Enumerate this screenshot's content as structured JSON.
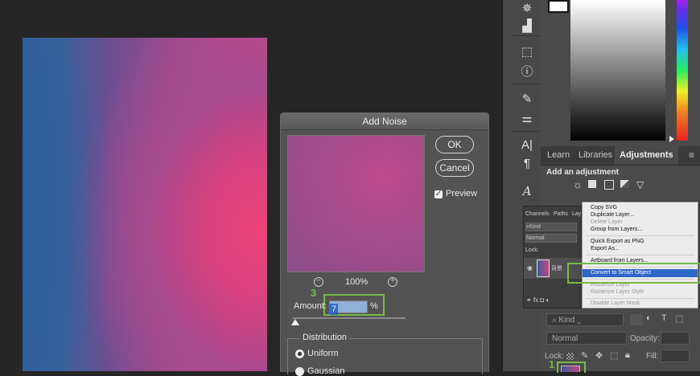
{
  "dialog": {
    "title": "Add Noise",
    "ok_label": "OK",
    "cancel_label": "Cancel",
    "preview_label": "Preview",
    "preview_checked": true,
    "zoom_level": "100%",
    "amount_label": "Amount:",
    "amount_value": "7",
    "amount_unit": "%",
    "distribution_label": "Distribution",
    "uniform_label": "Uniform",
    "gaussian_label": "Gaussian",
    "step_marker": "3"
  },
  "right_tabs": {
    "learn": "Learn",
    "libraries": "Libraries",
    "adjustments": "Adjustments"
  },
  "adjustments": {
    "title": "Add an adjustment"
  },
  "layers_small": {
    "tab_channels": "Channels",
    "tab_paths": "Paths",
    "tab_layers": "Lay",
    "kind_filter": "Kind",
    "blend_mode": "Normal",
    "lock_label": "Lock:",
    "layer_name": "背景"
  },
  "context_menu": {
    "items": [
      {
        "label": "Copy SVG",
        "disabled": false
      },
      {
        "label": "Duplicate Layer...",
        "disabled": false
      },
      {
        "label": "Delete Layer",
        "disabled": true
      },
      {
        "label": "Group from Layers...",
        "disabled": false
      },
      {
        "label": "Quick Export as PNG",
        "disabled": false
      },
      {
        "label": "Export As...",
        "disabled": false
      },
      {
        "label": "Artboard from Layers...",
        "disabled": false
      },
      {
        "label": "Convert to Smart Object",
        "disabled": false,
        "highlighted": true
      },
      {
        "label": "Rasterize Layer",
        "disabled": true
      },
      {
        "label": "Rasterize Layer Style",
        "disabled": true
      },
      {
        "label": "Disable Layer Mask",
        "disabled": true
      }
    ]
  },
  "layers_large": {
    "kind_filter": "Kind",
    "blend_mode": "Normal",
    "opacity_label": "Opacity:",
    "lock_label": "Lock:",
    "fill_label": "Fill:",
    "step_marker": "1"
  },
  "colors": {
    "highlight": "#2e66c9",
    "annotation_green": "#7ab84a"
  }
}
